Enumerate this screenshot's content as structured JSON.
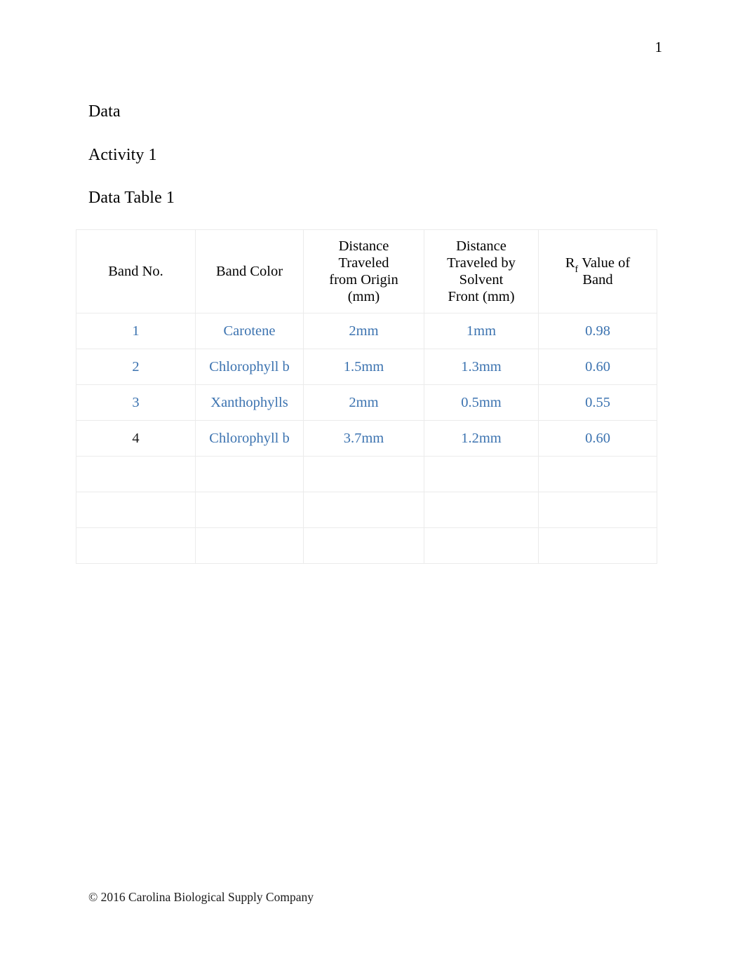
{
  "document": {
    "page_number": "1",
    "headings": {
      "data": "Data",
      "activity": "Activity 1",
      "table_title": "Data Table 1"
    },
    "footer": "© 2016 Carolina Biological Supply Company"
  },
  "table": {
    "name": "Data Table 1",
    "headers": {
      "band_no": "Band No.",
      "band_color": "Band Color",
      "distance_origin": "Distance Traveled from Origin (mm)",
      "distance_solvent": "Distance Traveled by Solvent Front (mm)",
      "rf_prefix": "R",
      "rf_subscript": "f",
      "rf_suffix": "Value of Band"
    },
    "header_lines": {
      "distance_origin": [
        "Distance",
        "Traveled",
        "from Origin",
        "(mm)"
      ],
      "distance_solvent": [
        "Distance",
        "Traveled by",
        "Solvent",
        "Front (mm)"
      ],
      "rf_line2": "Band"
    },
    "rows": [
      {
        "band_no": "1",
        "band_color": "Carotene",
        "distance_origin": "2mm",
        "distance_solvent": "1mm",
        "rf_value": "0.98",
        "band_no_color": "#3c73b0"
      },
      {
        "band_no": "2",
        "band_color": "Chlorophyll b",
        "distance_origin": "1.5mm",
        "distance_solvent": "1.3mm",
        "rf_value": "0.60",
        "band_no_color": "#3c73b0"
      },
      {
        "band_no": "3",
        "band_color": "Xanthophylls",
        "distance_origin": "2mm",
        "distance_solvent": "0.5mm",
        "rf_value": "0.55",
        "band_no_color": "#3c73b0"
      },
      {
        "band_no": "4",
        "band_color": "Chlorophyll b",
        "distance_origin": "3.7mm",
        "distance_solvent": "1.2mm",
        "rf_value": "0.60",
        "band_no_color": "#1a1a1a"
      }
    ],
    "empty_row_count": 3
  },
  "colors": {
    "data_blue": "#3c73b0",
    "border_gray": "#ebebeb",
    "text_black": "#000000",
    "page_background": "#ffffff"
  }
}
